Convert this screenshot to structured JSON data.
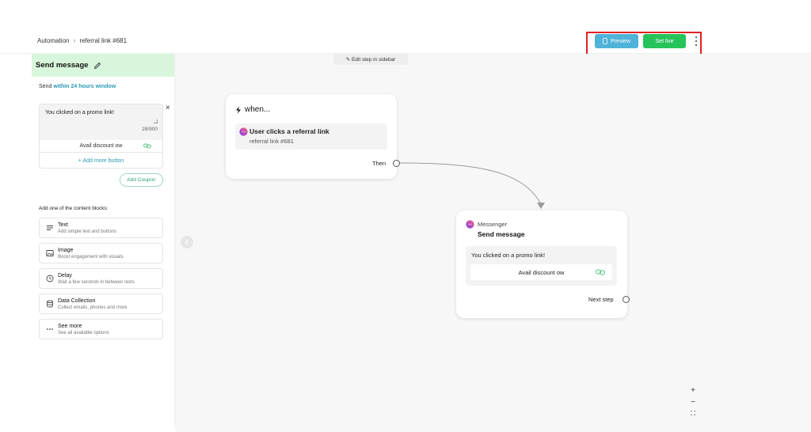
{
  "breadcrumb": {
    "root": "Automation",
    "current": "referral link #681"
  },
  "toolbar": {
    "preview_label": "Preview",
    "setlive_label": "Set live"
  },
  "sidebar": {
    "title": "Send message",
    "send_prefix": "Send",
    "send_window": "within 24 hours window",
    "message_text": "You clicked on a promo link!",
    "char_count": "28/900",
    "button_label": "Avail discount ow",
    "add_more_button": "+ Add more button",
    "add_coupon": "Add Coupon",
    "blocks_label": "Add one of the content blocks:",
    "blocks": [
      {
        "icon": "text-lines-icon",
        "title": "Text",
        "subtitle": "Add simple text and buttons"
      },
      {
        "icon": "image-icon",
        "title": "Image",
        "subtitle": "Boost engagement with visuals"
      },
      {
        "icon": "clock-icon",
        "title": "Delay",
        "subtitle": "Wait a few seconds in between texts"
      },
      {
        "icon": "database-icon",
        "title": "Data Collection",
        "subtitle": "Collect emails, phones and more"
      },
      {
        "icon": "dots-icon",
        "title": "See more",
        "subtitle": "See all available options"
      }
    ]
  },
  "canvas": {
    "edit_hint": "✎ Edit step in sidebar",
    "trigger_node": {
      "title": "when...",
      "trigger_title": "User clicks a referral link",
      "trigger_subtitle": "referral link #681",
      "then_label": "Then"
    },
    "send_node": {
      "channel": "Messenger",
      "title": "Send message",
      "message_text": "You clicked on a promo link!",
      "button_label": "Avail discount ow",
      "next_label": "Next step"
    },
    "zoom": {
      "in": "+",
      "out": "−",
      "fit": "⛶"
    }
  },
  "colors": {
    "preview": "#4fb3d9",
    "setlive": "#26c35a",
    "highlight": "#e02020",
    "sidebar_header": "#d8f6dc",
    "link": "#2a9bb5"
  }
}
